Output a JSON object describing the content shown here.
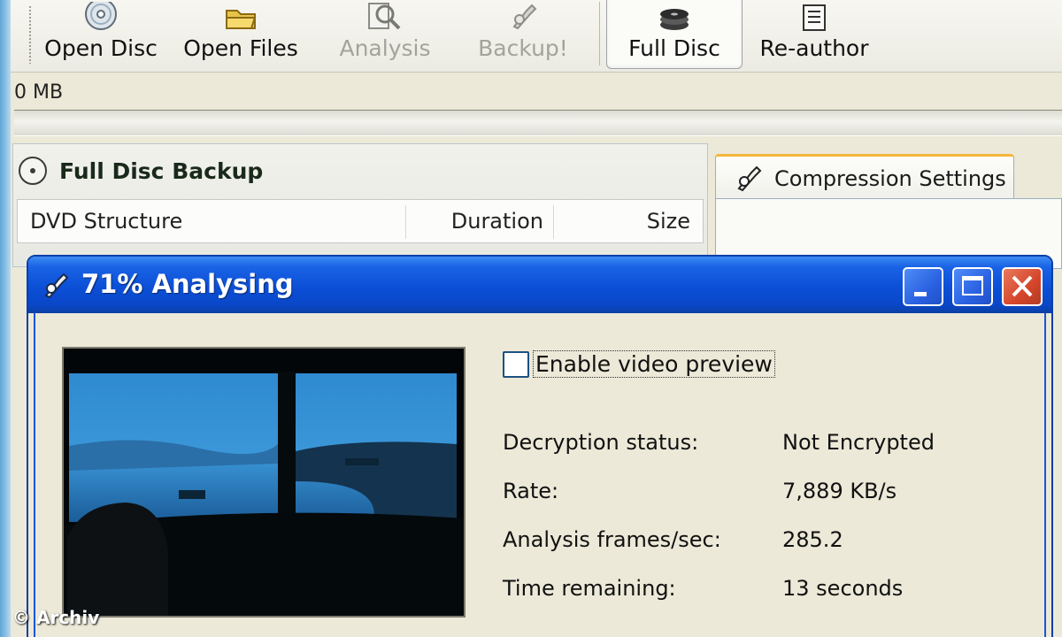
{
  "toolbar": {
    "buttons": [
      {
        "label": "Open Disc",
        "state": "enabled"
      },
      {
        "label": "Open Files",
        "state": "enabled"
      },
      {
        "label": "Analysis",
        "state": "disabled"
      },
      {
        "label": "Backup!",
        "state": "disabled"
      },
      {
        "label": "Full Disc",
        "state": "active"
      },
      {
        "label": "Re-author",
        "state": "enabled"
      }
    ]
  },
  "status": {
    "size_label": "0 MB",
    "progress_fraction": 0
  },
  "panel": {
    "title": "Full Disc Backup",
    "columns": [
      "DVD Structure",
      "Duration",
      "Size"
    ]
  },
  "tab": {
    "label": "Compression Settings"
  },
  "dialog": {
    "title": "71% Analysing",
    "enable_preview_label": "Enable video preview",
    "enable_preview_checked": false,
    "stats": [
      {
        "label": "Decryption status:",
        "value": "Not Encrypted"
      },
      {
        "label": "Rate:",
        "value": "7,889 KB/s"
      },
      {
        "label": "Analysis frames/sec:",
        "value": "285.2"
      },
      {
        "label": "Time remaining:",
        "value": "13 seconds"
      }
    ]
  },
  "watermark": "© Archiv",
  "icons": {
    "open_disc": "disc-icon",
    "open_files": "folder-icon",
    "analysis": "magnifier-icon",
    "backup": "wrench-icon",
    "full_disc": "disc-stack-icon",
    "re_author": "document-icon",
    "panel": "disc-icon",
    "tab": "wrench-icon",
    "dialog": "wrench-icon"
  },
  "colors": {
    "titlebar": "#0b4fd6",
    "close_button": "#d5462a",
    "tab_highlight": "#f4b63e"
  }
}
